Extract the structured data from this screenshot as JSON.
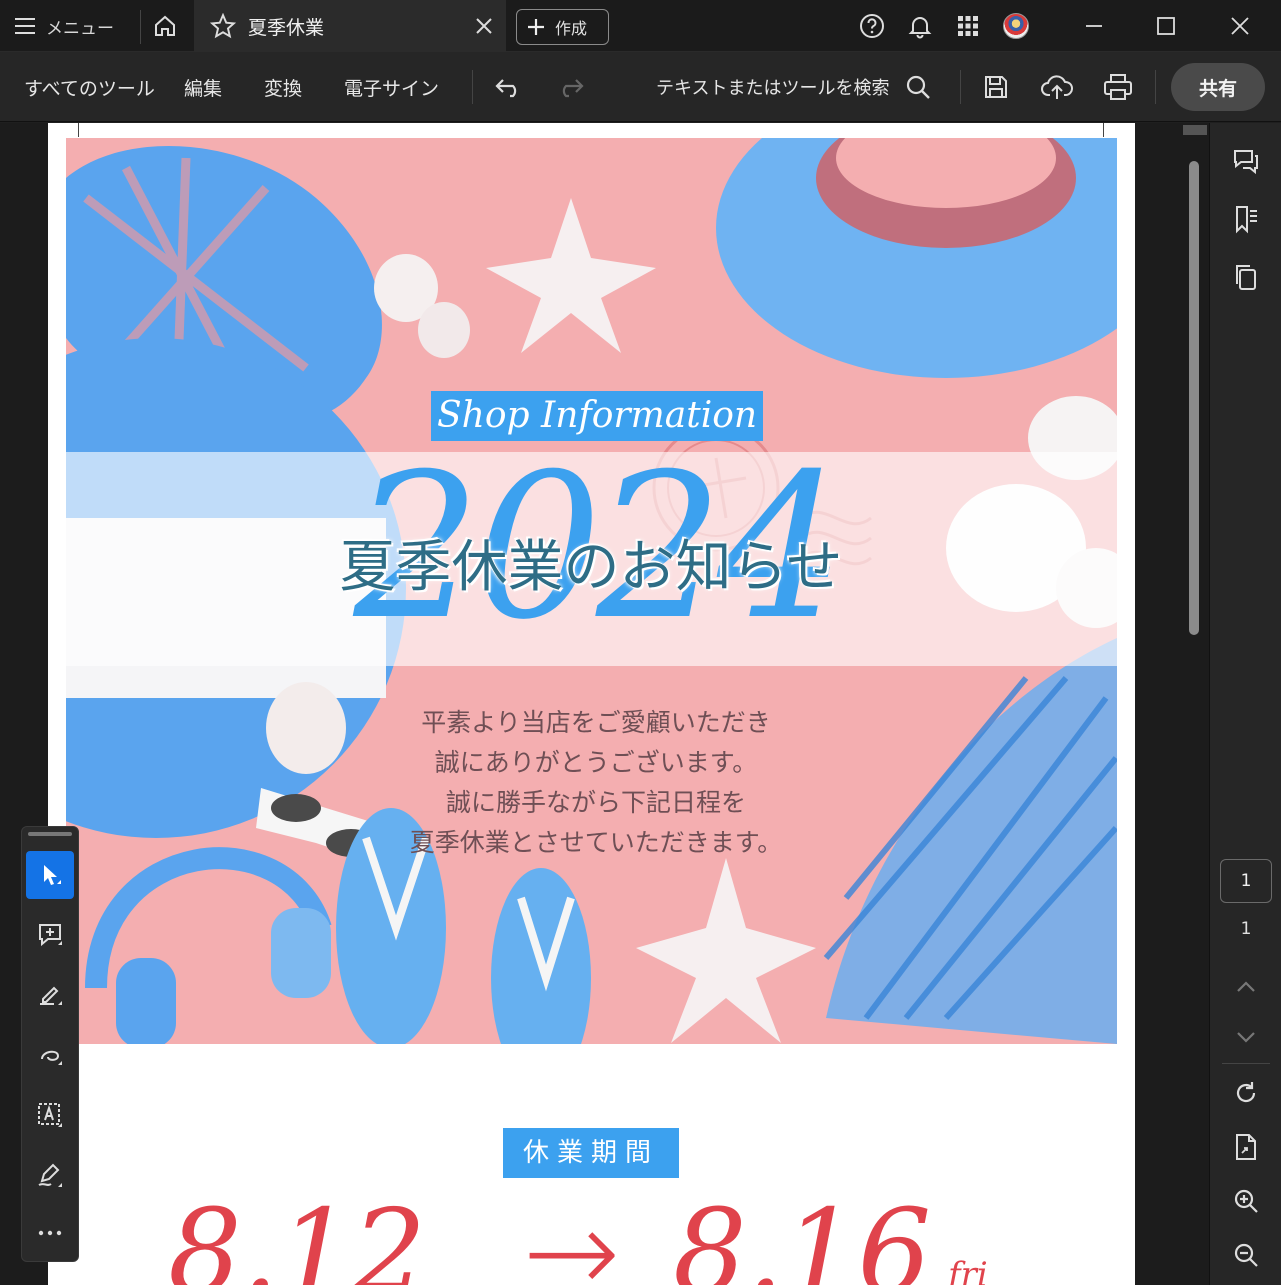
{
  "titlebar": {
    "menu_label": "メニュー",
    "tab_title": "夏季休業",
    "create_label": "作成"
  },
  "toolbar": {
    "all_tools": "すべてのツール",
    "edit": "編集",
    "convert": "変換",
    "esign": "電子サイン",
    "search_placeholder": "テキストまたはツールを検索",
    "share": "共有"
  },
  "document": {
    "shop_info": "Shop Information",
    "year": "2024",
    "notice_title": "夏季休業のお知らせ",
    "body_lines": [
      "平素より当店をご愛顧いただき",
      "誠にありがとうございます。",
      "誠に勝手ながら下記日程を",
      "夏季休業とさせていただきます。"
    ],
    "closed_label": "休業期間",
    "start_date": "8.12",
    "arrow": "→",
    "end_date": "8.16",
    "end_weekday": "fri"
  },
  "pagenav": {
    "current": "1",
    "total": "1"
  },
  "colors": {
    "accent_blue": "#3ca1ef",
    "hero_pink": "#f4aeb0",
    "date_red": "#e0434c",
    "select_blue": "#1473e6"
  },
  "icons": [
    "hamburger-icon",
    "home-icon",
    "star-icon",
    "close-icon",
    "plus-icon",
    "help-icon",
    "bell-icon",
    "apps-grid-icon",
    "minimize-icon",
    "maximize-icon",
    "window-close-icon",
    "undo-icon",
    "redo-icon",
    "search-icon",
    "save-icon",
    "upload-cloud-icon",
    "print-icon",
    "comment-icon",
    "bookmark-icon",
    "copy-pages-icon",
    "select-arrow-icon",
    "add-comment-icon",
    "highlight-icon",
    "draw-icon",
    "text-recognize-icon",
    "sign-icon",
    "more-icon",
    "chevron-up-icon",
    "chevron-down-icon",
    "refresh-icon",
    "page-file-icon",
    "zoom-in-icon",
    "zoom-out-icon"
  ]
}
